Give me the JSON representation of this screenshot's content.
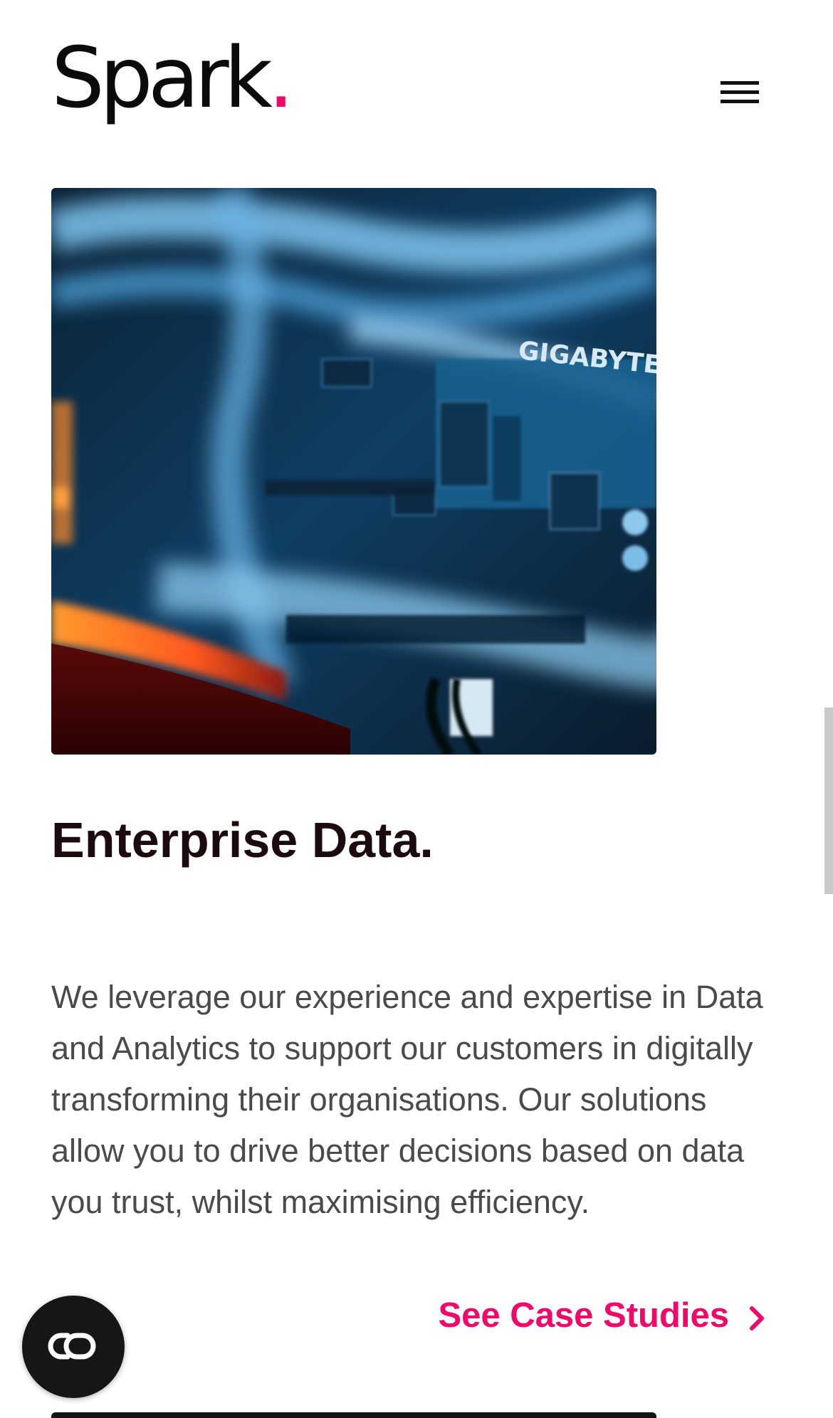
{
  "header": {
    "logo_text": "Spark",
    "logo_dot": ".",
    "menu_icon": "hamburger-menu-icon"
  },
  "hero": {
    "image_caption": "GIGABYTE",
    "image_subject": "close-up of motherboard with blue and orange lighting"
  },
  "section": {
    "title": "Enterprise Data.",
    "body": "We leverage our experience and expertise in Data and Analytics to support our customers in digitally transforming their organisations. Our solutions allow you to drive better decisions based on data you trust, whilst maximising efficiency.",
    "link_label": "See Case Studies",
    "link_icon": "chevron-right-icon"
  },
  "accessibility": {
    "icon": "accessibility-toggle-icon"
  },
  "colors": {
    "accent": "#ef0a6a",
    "heading": "#1b0a0e",
    "body_text": "#4a4a4a"
  }
}
